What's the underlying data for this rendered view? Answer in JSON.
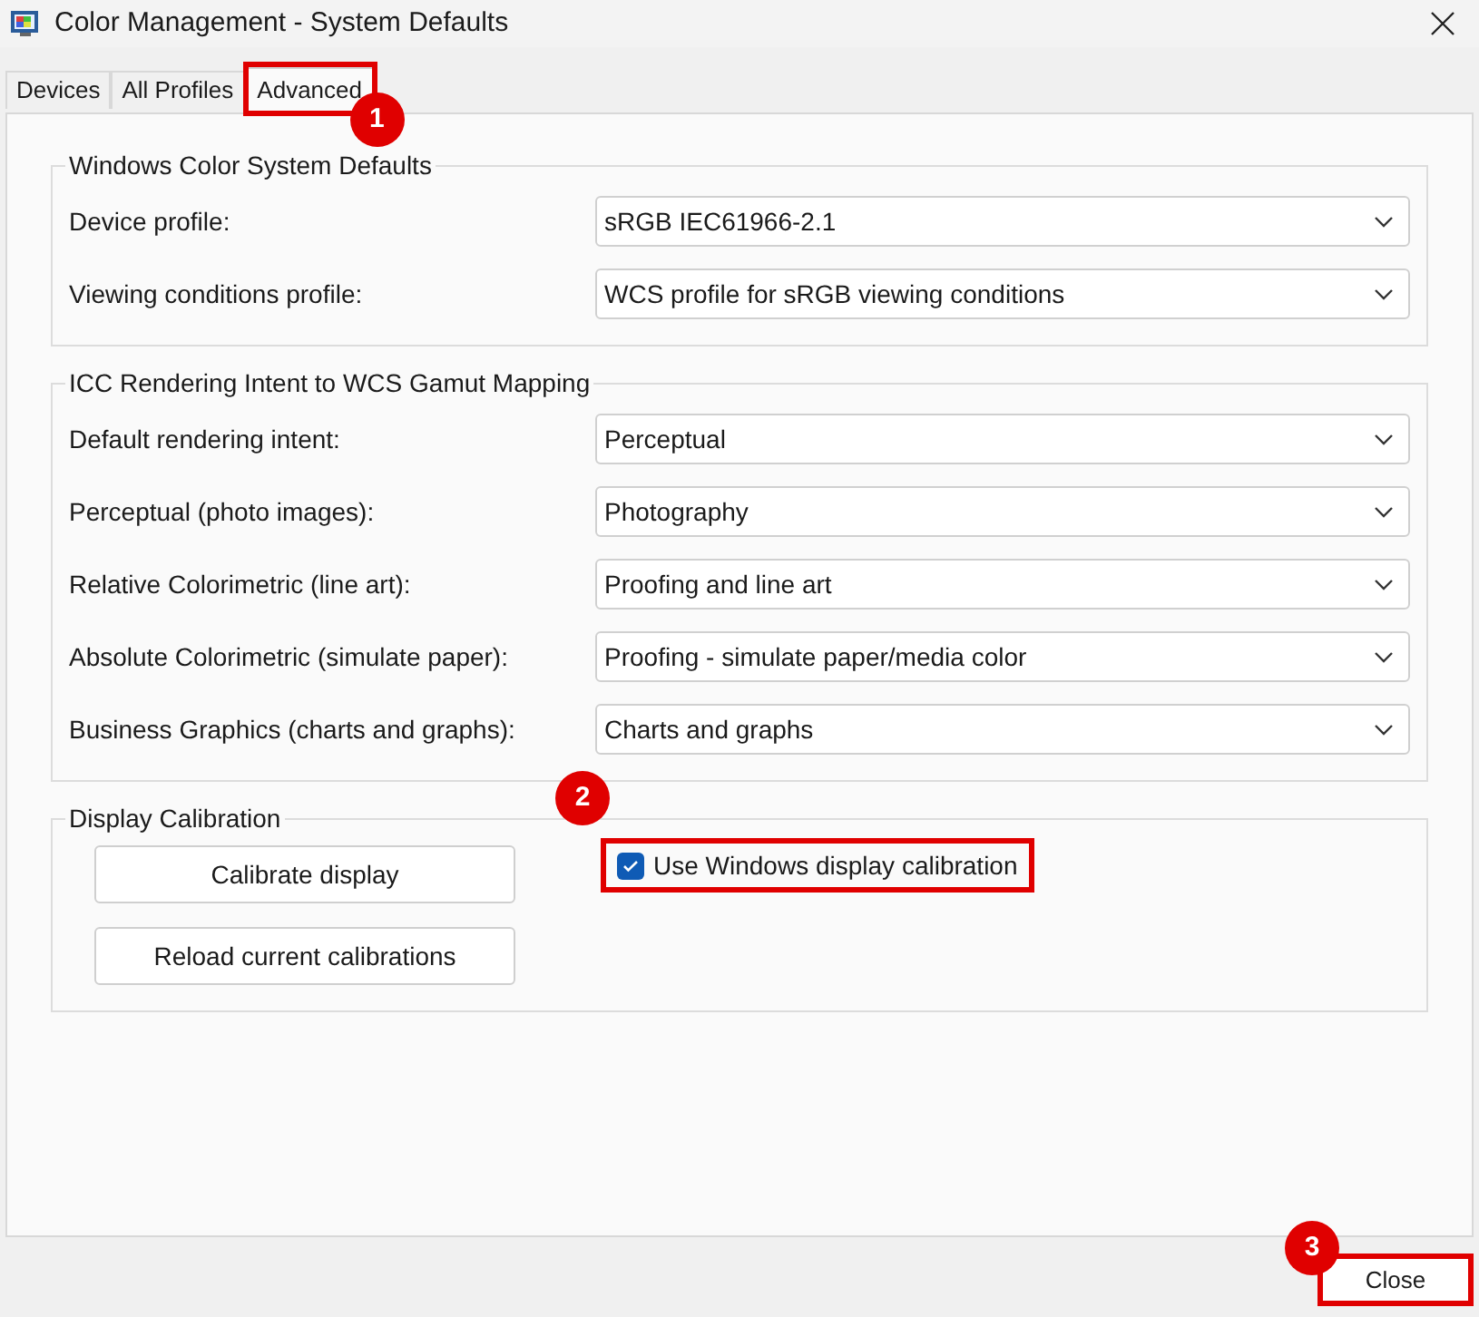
{
  "window": {
    "title": "Color Management - System Defaults"
  },
  "tabs": [
    {
      "label": "Devices",
      "selected": false
    },
    {
      "label": "All Profiles",
      "selected": false
    },
    {
      "label": "Advanced",
      "selected": true,
      "callout": "1"
    }
  ],
  "groups": [
    {
      "title": "Windows Color System Defaults",
      "rows": [
        {
          "label": "Device profile:",
          "value": "sRGB IEC61966-2.1"
        },
        {
          "label": "Viewing conditions profile:",
          "value": "WCS profile for sRGB viewing conditions"
        }
      ]
    },
    {
      "title": "ICC Rendering Intent to WCS Gamut Mapping",
      "rows": [
        {
          "label": "Default rendering intent:",
          "value": "Perceptual"
        },
        {
          "label": "Perceptual (photo images):",
          "value": "Photography"
        },
        {
          "label": "Relative Colorimetric (line art):",
          "value": "Proofing and line art"
        },
        {
          "label": "Absolute Colorimetric (simulate paper):",
          "value": "Proofing - simulate paper/media color"
        },
        {
          "label": "Business Graphics (charts and graphs):",
          "value": "Charts and graphs"
        }
      ]
    }
  ],
  "calibration": {
    "title": "Display Calibration",
    "buttons": [
      "Calibrate display",
      "Reload current calibrations"
    ],
    "checkbox": {
      "label": "Use Windows display calibration",
      "checked": true,
      "callout": "2"
    }
  },
  "close_button": {
    "label": "Close",
    "callout": "3"
  }
}
